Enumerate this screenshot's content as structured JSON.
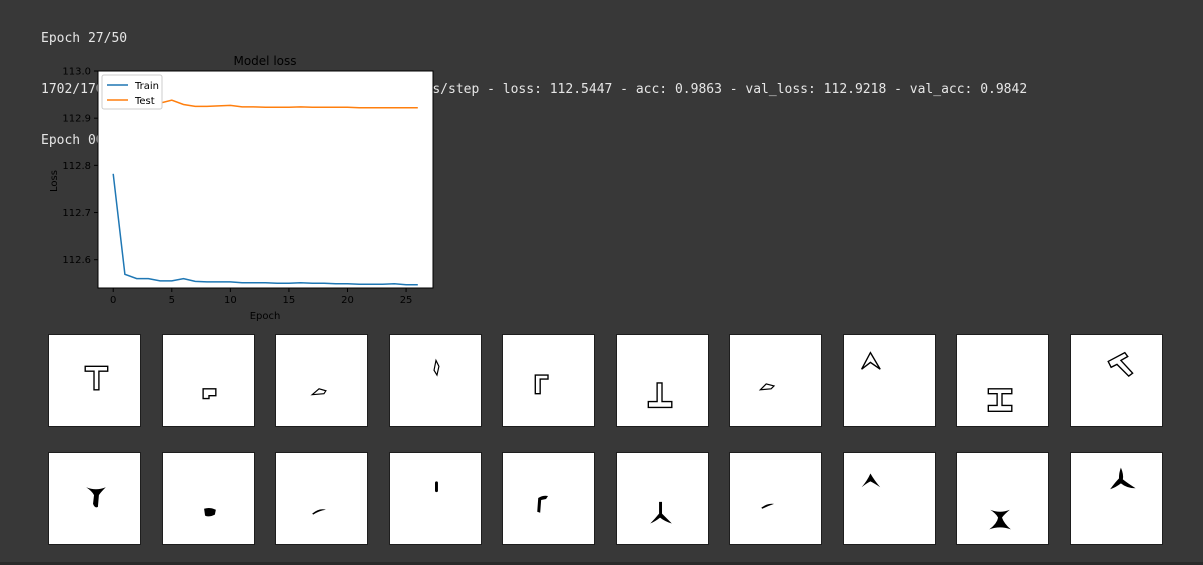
{
  "console": {
    "line1": "Epoch 27/50",
    "line2": "1702/1702 [==============================] - 6s 3ms/step - loss: 112.5447 - acc: 0.9863 - val_loss: 112.9218 - val_acc: 0.9842",
    "line3": "Epoch 00027: early stopping"
  },
  "chart_data": {
    "type": "line",
    "title": "Model loss",
    "xlabel": "Epoch",
    "ylabel": "Loss",
    "xlim": [
      -1.3,
      27.3
    ],
    "ylim": [
      112.54,
      113.0
    ],
    "xticks": [
      0,
      5,
      10,
      15,
      20,
      25
    ],
    "yticks": [
      112.6,
      112.7,
      112.8,
      112.9,
      113.0
    ],
    "yticklabels": [
      "112.6",
      "112.7",
      "112.8",
      "112.9",
      "113.0"
    ],
    "legend_position": "upper-left",
    "grid": false,
    "series": [
      {
        "name": "Train",
        "color": "#1f77b4",
        "x": [
          0,
          1,
          2,
          3,
          4,
          5,
          6,
          7,
          8,
          9,
          10,
          11,
          12,
          13,
          14,
          15,
          16,
          17,
          18,
          19,
          20,
          21,
          22,
          23,
          24,
          25,
          26
        ],
        "values": [
          112.782,
          112.569,
          112.56,
          112.56,
          112.555,
          112.555,
          112.56,
          112.554,
          112.553,
          112.553,
          112.553,
          112.551,
          112.551,
          112.551,
          112.55,
          112.55,
          112.551,
          112.55,
          112.55,
          112.549,
          112.549,
          112.548,
          112.548,
          112.548,
          112.549,
          112.547,
          112.547
        ]
      },
      {
        "name": "Test",
        "color": "#ff7f0e",
        "x": [
          0,
          1,
          2,
          3,
          4,
          5,
          6,
          7,
          8,
          9,
          10,
          11,
          12,
          13,
          14,
          15,
          16,
          17,
          18,
          19,
          20,
          21,
          22,
          23,
          24,
          25,
          26
        ],
        "values": [
          112.965,
          112.945,
          112.935,
          112.93,
          112.932,
          112.938,
          112.929,
          112.925,
          112.925,
          112.926,
          112.927,
          112.924,
          112.924,
          112.923,
          112.923,
          112.923,
          112.924,
          112.923,
          112.923,
          112.923,
          112.923,
          112.922,
          112.922,
          112.922,
          112.922,
          112.922,
          112.922
        ]
      }
    ]
  },
  "thumbnails": {
    "row1": [
      "t-outline",
      "small-square-outline",
      "parallelogram-outline",
      "leaf-outline",
      "corner-outline",
      "inverted-t-outline",
      "parallelogram-outline-2",
      "chevron-outline",
      "i-beam-outline",
      "rotated-t-outline"
    ],
    "row2": [
      "t-blob",
      "square-blob",
      "dash-blob",
      "bar-blob",
      "corner-blob",
      "tripod-blob",
      "dash-blob-2",
      "arrow-blob",
      "i-beam-blob",
      "tripod-blob-2"
    ]
  }
}
